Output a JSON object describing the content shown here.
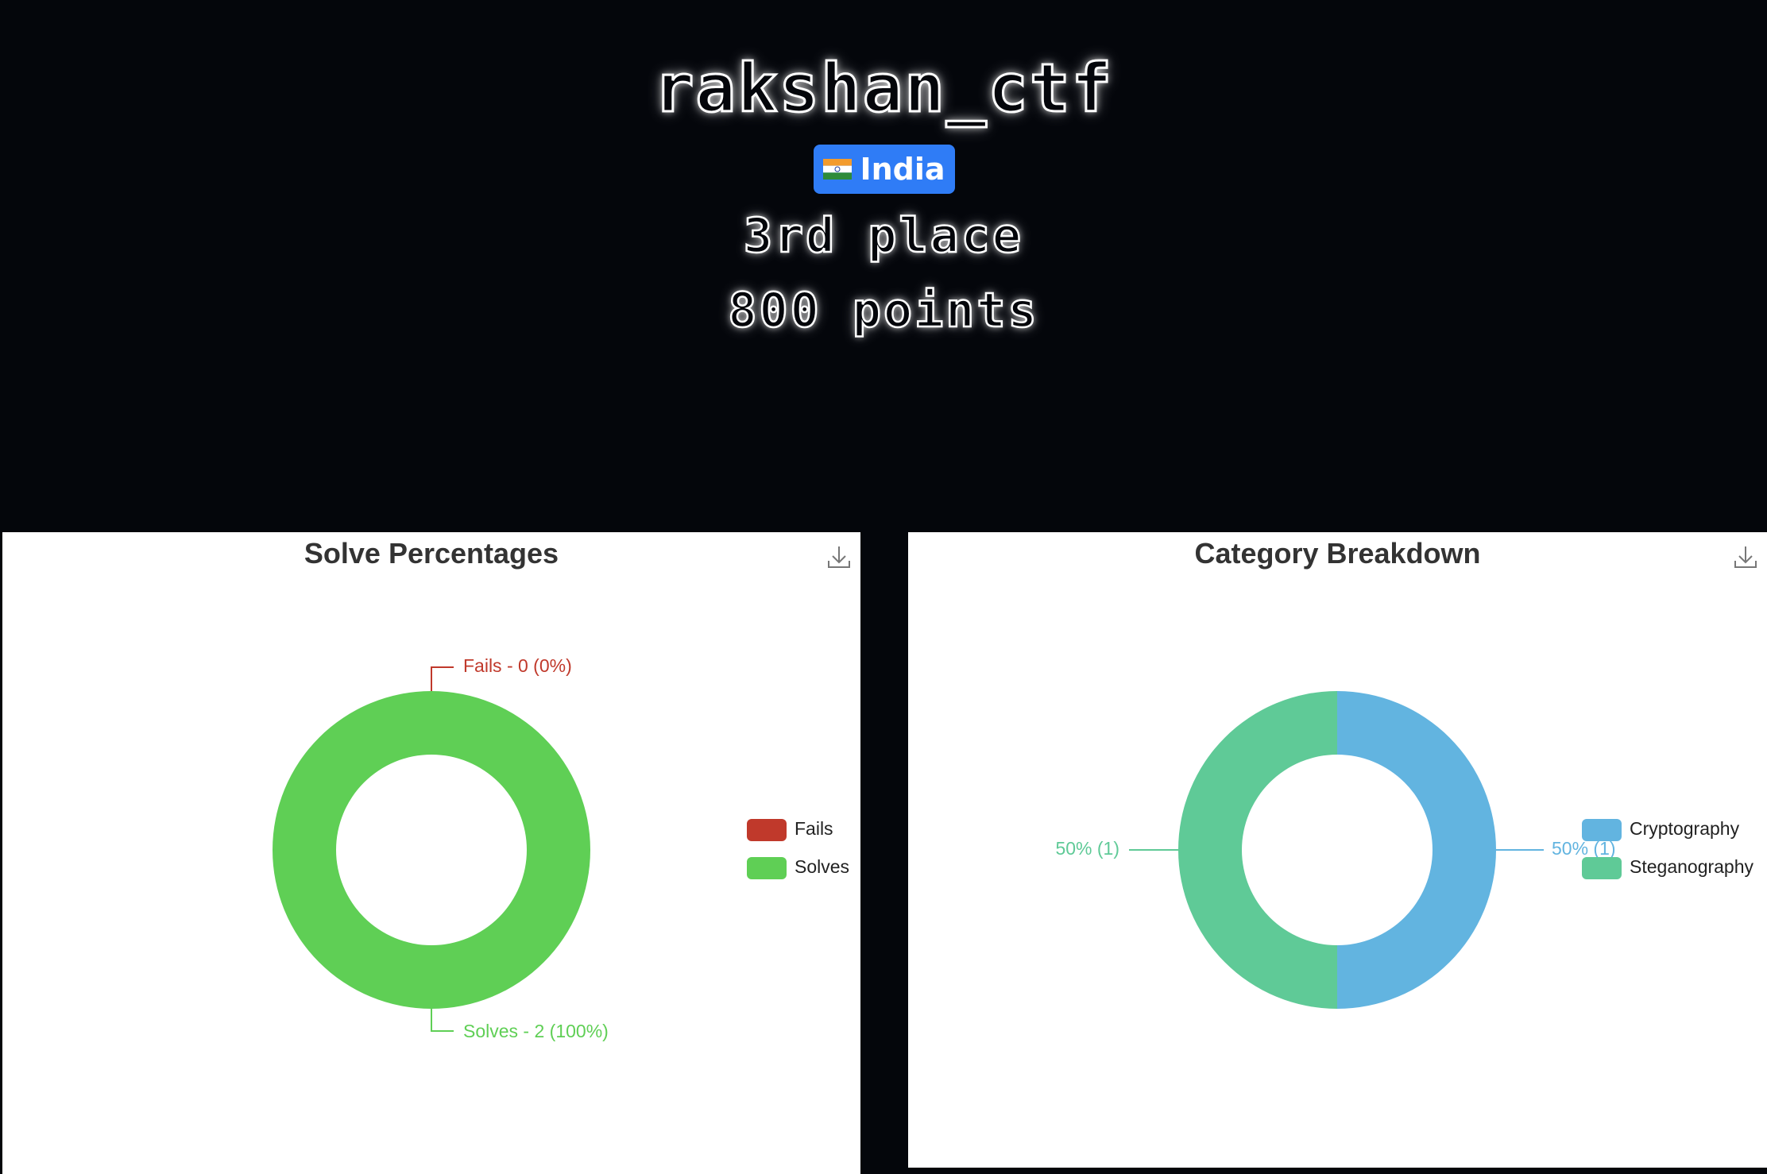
{
  "team": {
    "name": "rakshan_ctf",
    "country": "India",
    "place": "3rd place",
    "points": "800 points"
  },
  "colors": {
    "badge": "#2f7cf6",
    "fails": "#c0392b",
    "solves": "#5fcf55",
    "cryptography": "#62b4e0",
    "steganography": "#5fca97"
  },
  "icons": {
    "download": "download-icon",
    "flag": "india-flag-icon"
  },
  "chart_data": [
    {
      "type": "pie",
      "title": "Solve Percentages",
      "donut": true,
      "legend_position": "right",
      "series": [
        {
          "name": "Fails",
          "value": 0,
          "label": "Fails - 0 (0%)",
          "color": "#c0392b"
        },
        {
          "name": "Solves",
          "value": 2,
          "label": "Solves - 2 (100%)",
          "color": "#5fcf55"
        }
      ]
    },
    {
      "type": "pie",
      "title": "Category Breakdown",
      "donut": true,
      "legend_position": "right",
      "series": [
        {
          "name": "Cryptography",
          "value": 1,
          "label": "50% (1)",
          "color": "#62b4e0"
        },
        {
          "name": "Steganography",
          "value": 1,
          "label": "50% (1)",
          "color": "#5fca97"
        }
      ]
    }
  ]
}
